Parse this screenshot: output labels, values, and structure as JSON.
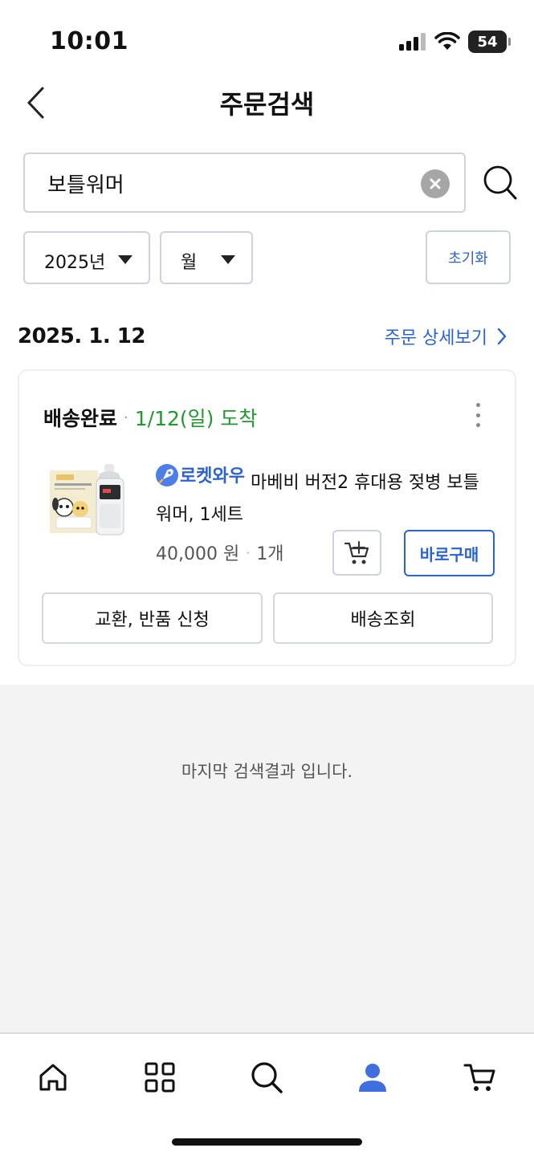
{
  "status_bar": {
    "time": "10:01",
    "battery": "54",
    "icons": [
      "signal-icon",
      "wifi-icon",
      "battery-icon"
    ]
  },
  "header": {
    "title": "주문검색",
    "back_icon": "chevron-left-icon"
  },
  "search": {
    "value": "보틀워머",
    "clear_icon": "clear-icon",
    "search_icon": "search-icon"
  },
  "filters": {
    "year": "2025년",
    "month": "월",
    "reset_label": "초기화"
  },
  "order": {
    "date": "2025. 1. 12",
    "detail_link": "주문 상세보기",
    "status": "배송완료",
    "arrival": "1/12(일) 도착",
    "product": {
      "badge": "로켓와우",
      "name": "마베비 버전2 휴대용 젖병 보틀 워머, 1세트",
      "price": "40,000 원",
      "quantity": "1개"
    },
    "buy_now_label": "바로구매",
    "exchange_label": "교환, 반품 신청",
    "tracking_label": "배송조회"
  },
  "end_message": "마지막 검색결과 입니다.",
  "bottom_nav": {
    "items": [
      "home-icon",
      "category-icon",
      "search-icon",
      "my-page-icon",
      "cart-icon"
    ],
    "active": "my-page-icon"
  },
  "colors": {
    "accent": "#2a63d4",
    "arrival_green": "#1f9a2f",
    "active_nav": "#3d6fe0"
  }
}
